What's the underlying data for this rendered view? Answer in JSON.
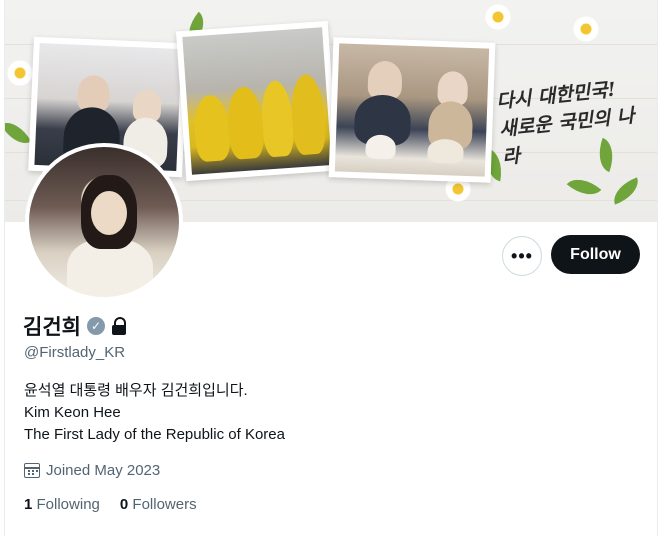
{
  "banner": {
    "slogan_line1": "다시 대한민국!",
    "slogan_line2": "새로운 국민의 나라"
  },
  "profile": {
    "display_name": "김건희",
    "handle": "@Firstlady_KR",
    "bio": [
      "윤석열 대통령 배우자 김건희입니다.",
      "Kim Keon Hee",
      "The First Lady of the Republic of Korea"
    ],
    "joined": "Joined May 2023",
    "following_count": "1",
    "following_label": "Following",
    "followers_count": "0",
    "followers_label": "Followers"
  },
  "actions": {
    "more_glyph": "•••",
    "follow_label": "Follow"
  },
  "icons": {
    "verified": "verified-badge-icon",
    "lock": "lock-icon",
    "calendar": "calendar-icon",
    "more": "more-icon"
  },
  "colors": {
    "follow_bg": "#0f1419",
    "secondary_text": "#536471",
    "verified_badge": "#829aab"
  }
}
